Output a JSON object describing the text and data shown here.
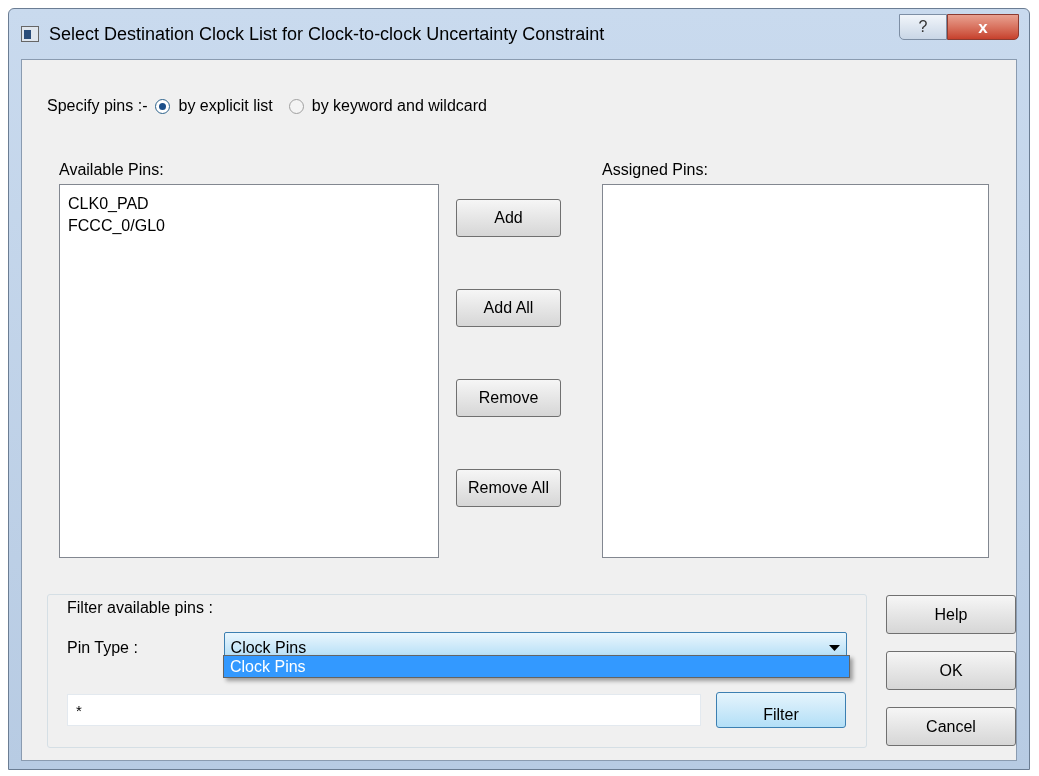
{
  "window": {
    "title": "Select Destination Clock List for Clock-to-clock Uncertainty Constraint",
    "help_glyph": "?",
    "close_glyph": "x"
  },
  "specify": {
    "label": "Specify pins :-",
    "options": [
      {
        "label": "by explicit list",
        "selected": true
      },
      {
        "label": "by keyword and wildcard",
        "selected": false
      }
    ]
  },
  "available": {
    "label": "Available Pins:",
    "items": [
      "CLK0_PAD",
      "FCCC_0/GL0"
    ]
  },
  "middle_buttons": [
    "Add",
    "Add All",
    "Remove",
    "Remove All"
  ],
  "assigned": {
    "label": "Assigned Pins:"
  },
  "filter": {
    "label": "Filter available pins :",
    "pin_type_label": "Pin Type :",
    "pin_type_value": "Clock Pins",
    "dropdown_expanded": true,
    "dropdown_items": [
      {
        "label": "Clock Pins",
        "selected": true
      }
    ],
    "pattern": "*",
    "filter_button": "Filter"
  },
  "side_buttons": [
    "Help",
    "OK",
    "Cancel"
  ]
}
